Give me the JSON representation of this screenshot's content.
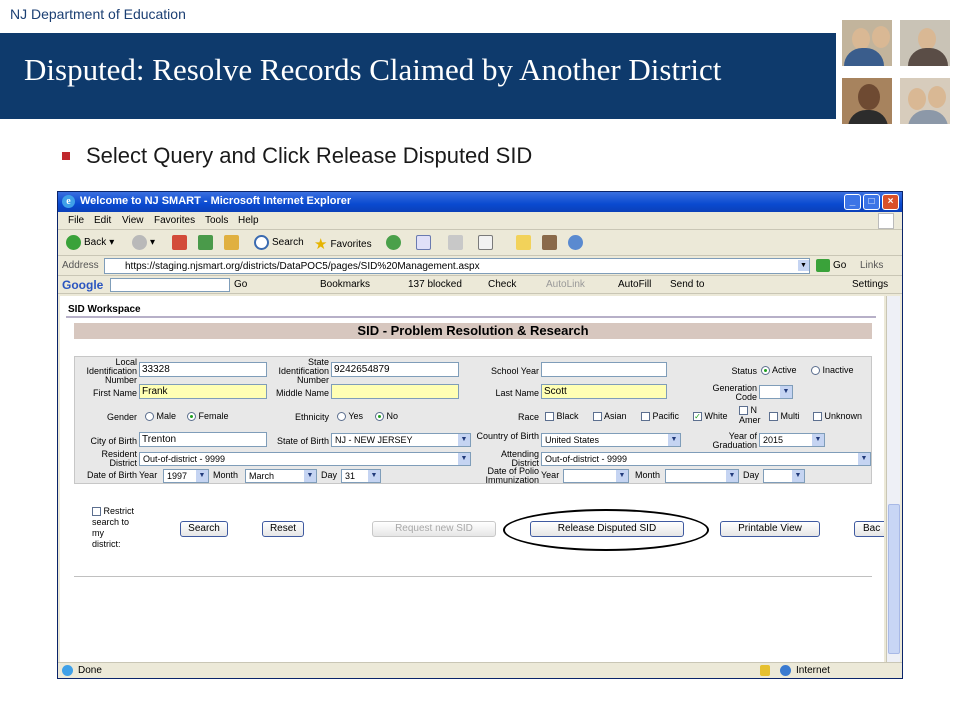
{
  "slide": {
    "department": "NJ Department of Education",
    "title": "Disputed: Resolve Records Claimed by Another District",
    "bullet": "Select Query and Click Release Disputed SID"
  },
  "browser": {
    "window_title": "Welcome to NJ SMART - Microsoft Internet Explorer",
    "menu": [
      "File",
      "Edit",
      "View",
      "Favorites",
      "Tools",
      "Help"
    ],
    "toolbar": {
      "back": "Back",
      "search": "Search",
      "favorites": "Favorites"
    },
    "address_label": "Address",
    "url": "https://staging.njsmart.org/districts/DataPOC5/pages/SID%20Management.aspx",
    "go": "Go",
    "links": "Links",
    "google_bar": {
      "logo": "Google",
      "go": "Go",
      "bookmarks": "Bookmarks",
      "blocked": "137 blocked",
      "check": "Check",
      "autolink": "AutoLink",
      "autofill": "AutoFill",
      "send_to": "Send to",
      "settings": "Settings"
    },
    "status_left": "Done",
    "status_zone": "Internet"
  },
  "workspace": {
    "label": "SID Workspace",
    "title": "SID - Problem Resolution & Research"
  },
  "form": {
    "local_id_label": "Local Identification Number",
    "local_id_value": "33328",
    "state_id_label": "State Identification Number",
    "state_id_value": "9242654879",
    "school_year_label": "School Year",
    "school_year_value": "",
    "status_label": "Status",
    "status_active": "Active",
    "status_inactive": "Inactive",
    "first_name_label": "First Name",
    "first_name_value": "Frank",
    "middle_name_label": "Middle Name",
    "middle_name_value": "",
    "last_name_label": "Last Name",
    "last_name_value": "Scott",
    "generation_code_label": "Generation Code",
    "gender_label": "Gender",
    "gender_male": "Male",
    "gender_female": "Female",
    "ethnicity_label": "Ethnicity",
    "ethnicity_yes": "Yes",
    "ethnicity_no": "No",
    "race_label": "Race",
    "race_black": "Black",
    "race_asian": "Asian",
    "race_pacific": "Pacific",
    "race_white": "White",
    "race_n_amer_1": "N",
    "race_n_amer_2": "Amer",
    "race_multi": "Multi",
    "race_unknown": "Unknown",
    "city_of_birth_label": "City of Birth",
    "city_of_birth_value": "Trenton",
    "state_of_birth_label": "State of Birth",
    "state_of_birth_value": "NJ - NEW JERSEY",
    "country_of_birth_label": "Country of Birth",
    "country_of_birth_value": "United States",
    "year_of_graduation_label": "Year of Graduation",
    "year_of_graduation_value": "2015",
    "resident_district_label": "Resident District",
    "resident_district_value": "Out-of-district - 9999",
    "attending_district_label": "Attending District",
    "attending_district_value": "Out-of-district - 9999",
    "dob_label": "Date of Birth",
    "dob_year_label": "Year",
    "dob_year_value": "1997",
    "dob_month_label": "Month",
    "dob_month_value": "March",
    "dob_day_label": "Day",
    "dob_day_value": "31",
    "polio_label": "Date of Polio Immunization",
    "polio_year_label": "Year",
    "polio_month_label": "Month",
    "polio_day_label": "Day"
  },
  "actions": {
    "restrict_line1": "Restrict",
    "restrict_line2": "search to",
    "restrict_line3": "my",
    "restrict_line4": "district:",
    "search": "Search",
    "reset": "Reset",
    "request_new_sid": "Request new SID",
    "release_disputed_sid": "Release Disputed SID",
    "printable_view": "Printable View",
    "back_partial": "Bac"
  },
  "colors": {
    "banner": "#0e3a6c",
    "bullet": "#c0282d",
    "highlight_field": "#ffffb4",
    "section_title_bg": "#d7c7bf"
  }
}
